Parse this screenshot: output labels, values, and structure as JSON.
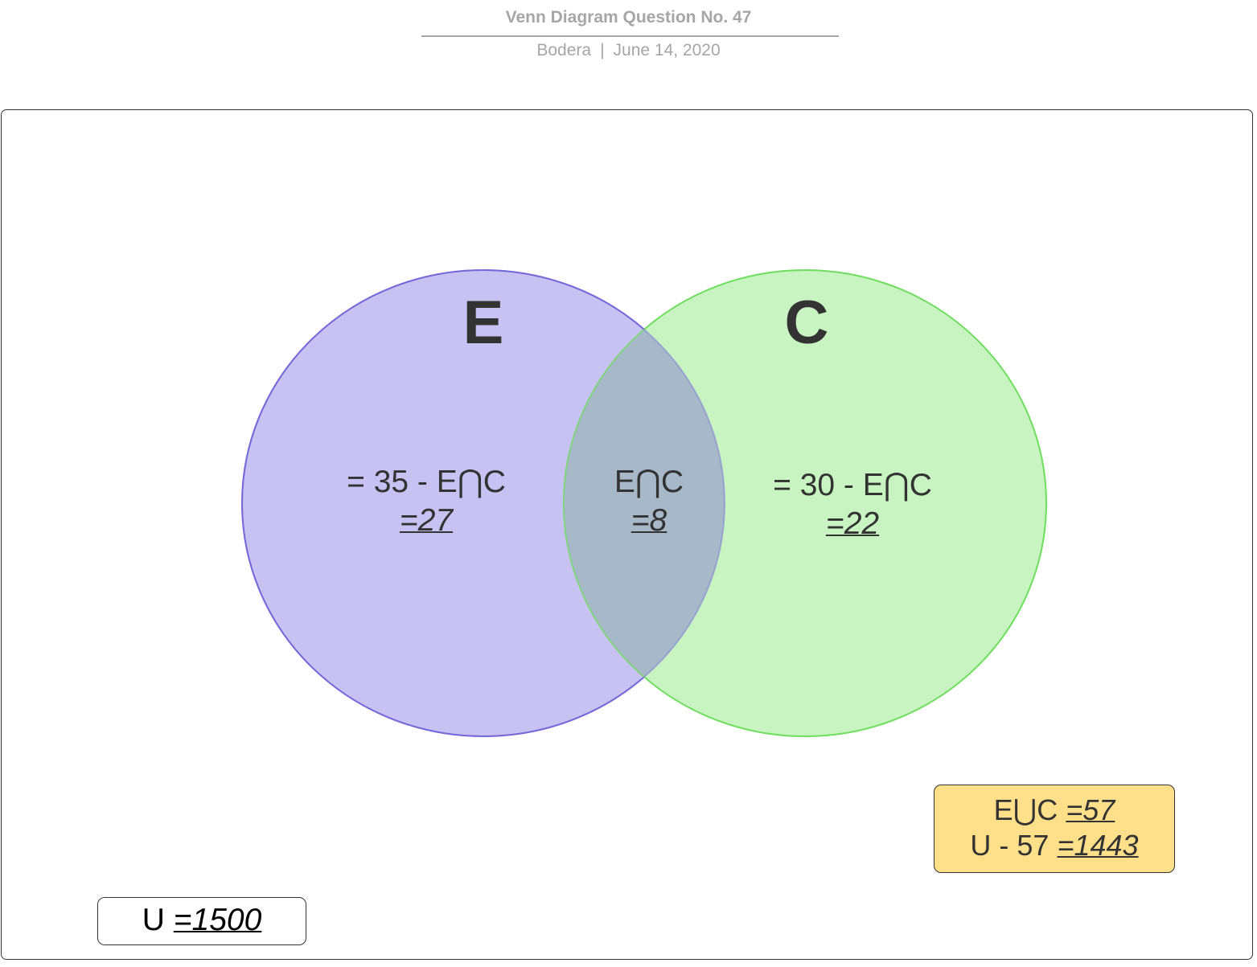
{
  "header": {
    "title": "Venn Diagram Question No. 47",
    "author": "Bodera",
    "separator": "|",
    "date": "June 14, 2020"
  },
  "colors": {
    "set_e_fill": "#c7c2f2",
    "set_e_stroke": "#7668d9",
    "set_c_fill": "#c8f4c2",
    "set_c_stroke": "#72de62",
    "intersection_fill": "#a7b8c9",
    "union_box_fill": "#ffe08a"
  },
  "sets": {
    "e": {
      "label": "E",
      "region_expr": "= 35 - E⋂C",
      "region_value": "=27"
    },
    "c": {
      "label": "C",
      "region_expr": "= 30 - E⋂C",
      "region_value": "=22"
    },
    "intersection": {
      "expr": "E⋂C",
      "value": "=8"
    }
  },
  "union_box": {
    "line1_label": "E⋃C",
    "line1_value": "=57",
    "line2_label": "U - 57",
    "line2_value": "=1443"
  },
  "universe_box": {
    "label": "U",
    "value": "=1500"
  }
}
